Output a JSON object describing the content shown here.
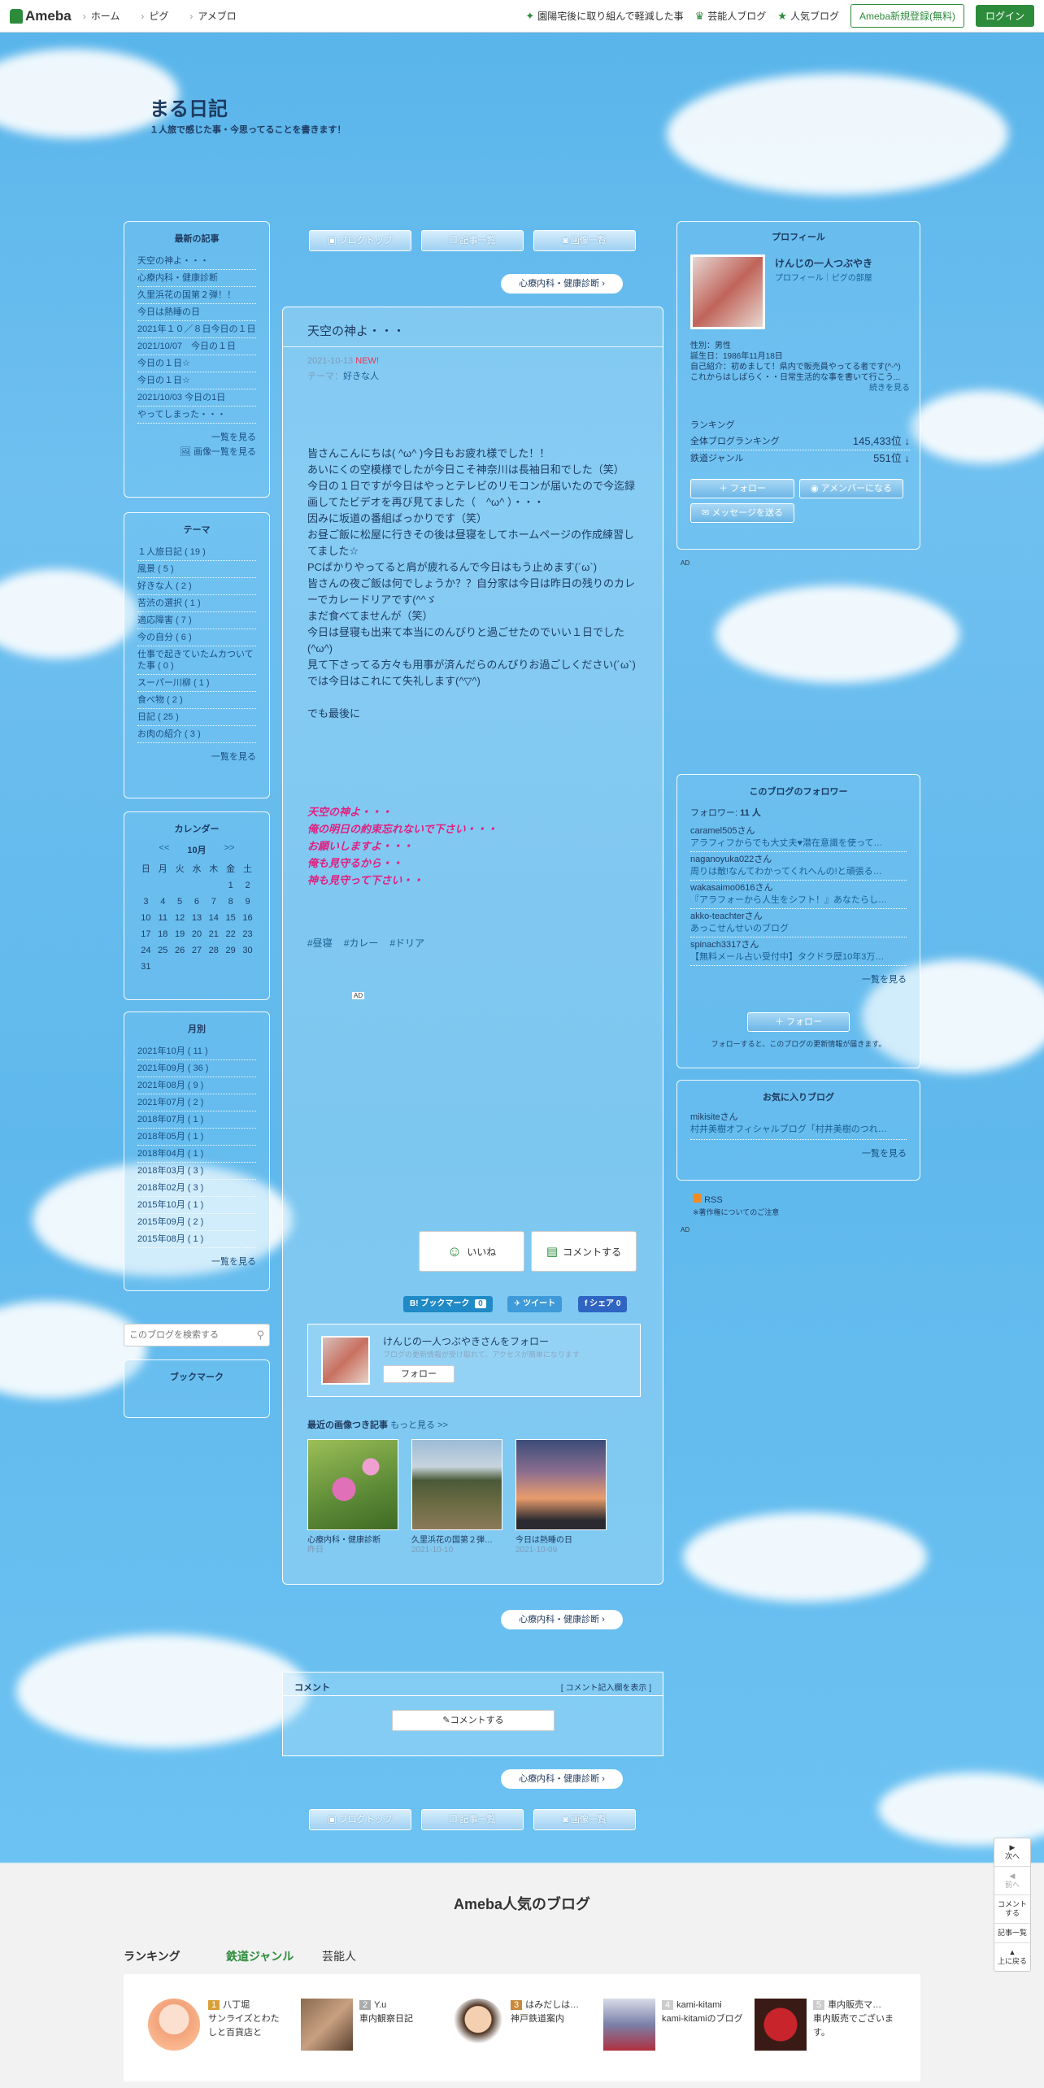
{
  "topbar": {
    "logo": "Ameba",
    "nav": [
      "ホーム",
      "ピグ",
      "アメブロ"
    ],
    "links": [
      "園陽宅後に取り組んで軽減した事",
      "芸能人ブログ",
      "人気ブログ"
    ],
    "register": "Ameba新規登録(無料)",
    "login": "ログイン"
  },
  "blog": {
    "title": "まる日記",
    "description": "１人旅で感じた事・今思ってることを書きます！"
  },
  "nav_buttons": {
    "top": "ブログトップ",
    "list": "記事一覧",
    "images": "画像一覧"
  },
  "next_article": "心療内科・健康診断",
  "latest": {
    "heading": "最新の記事",
    "items": [
      "天空の神よ・・・",
      "心療内科・健康診断",
      "久里浜花の国第２弾！！",
      "今日は熱睡の日",
      "2021年１０／８日今日の１日",
      "2021/10/07　今日の１日",
      "今日の１日☆",
      "今日の１日☆",
      "2021/10/03 今日の1日",
      "やってしまった・・・"
    ],
    "more": "一覧を見る",
    "images_more": "画像一覧を見る"
  },
  "themes": {
    "heading": "テーマ",
    "items": [
      "１人旅日記 ( 19 )",
      "風景 ( 5 )",
      "好きな人 ( 2 )",
      "苦渋の選択 ( 1 )",
      "適応障害 ( 7 )",
      "今の自分 ( 6 )",
      "仕事で起きていたムカついてた事 ( 0 )",
      "スーパー川柳 ( 1 )",
      "食べ物 ( 2 )",
      "日記 ( 25 )",
      "お肉の紹介 ( 3 )"
    ],
    "more": "一覧を見る"
  },
  "calendar": {
    "heading": "カレンダー",
    "prev": "<<",
    "month": "10月",
    "next": ">>",
    "weekdays": [
      "日",
      "月",
      "火",
      "水",
      "木",
      "金",
      "土"
    ],
    "weeks": [
      [
        "",
        "",
        "",
        "",
        "",
        "1",
        "2"
      ],
      [
        "3",
        "4",
        "5",
        "6",
        "7",
        "8",
        "9"
      ],
      [
        "10",
        "11",
        "12",
        "13",
        "14",
        "15",
        "16"
      ],
      [
        "17",
        "18",
        "19",
        "20",
        "21",
        "22",
        "23"
      ],
      [
        "24",
        "25",
        "26",
        "27",
        "28",
        "29",
        "30"
      ],
      [
        "31",
        "",
        "",
        "",
        "",
        "",
        ""
      ]
    ]
  },
  "monthly": {
    "heading": "月別",
    "items": [
      "2021年10月 ( 11 )",
      "2021年09月 ( 36 )",
      "2021年08月 ( 9 )",
      "2021年07月 ( 2 )",
      "2018年07月 ( 1 )",
      "2018年05月 ( 1 )",
      "2018年04月 ( 1 )",
      "2018年03月 ( 3 )",
      "2018年02月 ( 3 )",
      "2015年10月 ( 1 )",
      "2015年09月 ( 2 )",
      "2015年08月 ( 1 )"
    ],
    "more": "一覧を見る"
  },
  "search": {
    "placeholder": "このブログを検索する"
  },
  "bookmark": {
    "heading": "ブックマーク"
  },
  "article": {
    "title": "天空の神よ・・・",
    "date": "2021-10-13",
    "new_badge": "NEW!",
    "theme_label": "テーマ：",
    "theme": "好きな人",
    "body": "皆さんこんにちは( ^ω^ )今日もお疲れ様でした！！\nあいにくの空模様でしたが今日こそ神奈川は長袖日和でした（笑）\n今日の１日ですが今日はやっとテレビのリモコンが届いたので今迄録画してたビデオを再び見てました（　^ω^ ）・・・\n因みに坂道の番組ばっかりです（笑）\nお昼ご飯に松屋に行きその後は昼寝をしてホームページの作成練習してました☆\nPCばかりやってると肩が疲れるんで今日はもう止めます(´ω`)\n皆さんの夜ご飯は何でしょうか？？自分家は今日は昨日の残りのカレーでカレードリアです(^^ゞ\nまだ食べてませんが（笑）\n今日は昼寝も出来て本当にのんびりと過ごせたのでいい１日でした(^ω^)\n見て下さってる方々も用事が済んだらのんびりお過ごしください(´ω`)\nでは今日はこれにて失礼します(^▽^)\n\nでも最後に",
    "pink": "天空の神よ・・・\n俺の明日の約束忘れないで下さい・・・\nお願いしますよ・・・\n俺も見守るから・・\n神も見守って下さい・・",
    "tags": [
      "#昼寝",
      "#カレー",
      "#ドリア"
    ],
    "ad": "AD",
    "like": "いいね",
    "comment_btn": "コメントする",
    "hatena": "B! ブックマーク",
    "hatena_count": "0",
    "tweet": "ツイート",
    "share": "シェア",
    "share_count": "0",
    "follow_title": "けんじの一人つぶやきさんをフォロー",
    "follow_sub": "ブログの更新情報が受け取れて、アクセスが簡単になります",
    "follow_btn": "フォロー",
    "recent_heading": "最近の画像つき記事",
    "recent_more": "もっと見る >>",
    "recent": [
      {
        "title": "心療内科・健康診断",
        "date": "昨日"
      },
      {
        "title": "久里浜花の国第２弾…",
        "date": "2021-10-10"
      },
      {
        "title": "今日は熱睡の日",
        "date": "2021-10-09"
      }
    ]
  },
  "comments": {
    "heading": "コメント",
    "show": "[ コメント記入欄を表示 ]",
    "button": "コメントする"
  },
  "profile": {
    "heading": "プロフィール",
    "name": "けんじの一人つぶやき",
    "sub": "プロフィール｜ピグの部屋",
    "gender": "性別：男性",
    "birthday": "誕生日：1986年11月18日",
    "intro": "自己紹介：初めまして！県内で販売員やってる者です(^-^) これからはしばらく・・日常生活的な事を書いて行こう...",
    "more": "続きを見る",
    "ranking_label": "ランキング",
    "rank1_label": "全体ブログランキング",
    "rank1": "145,433位",
    "rank2_label": "鉄道ジャンル",
    "rank2": "551位",
    "follow": "フォロー",
    "member": "アメンバーになる",
    "message": "メッセージを送る"
  },
  "followers": {
    "heading": "このブログのフォロワー",
    "count_label": "フォロワー:",
    "count": "11 人",
    "items": [
      {
        "name": "caramel505さん",
        "blog": "アラフィフからでも大丈夫♥潜在意識を使って…"
      },
      {
        "name": "naganoyuka022さん",
        "blog": "周りは敵!なんてわかってくれへんの!と頑張る…"
      },
      {
        "name": "wakasaimo0616さん",
        "blog": "『アラフォーから人生をシフト！』あなたらし…"
      },
      {
        "name": "akko-teachterさん",
        "blog": "あっこせんせいのブログ"
      },
      {
        "name": "spinach3317さん",
        "blog": "【無料メール占い受付中】タクドラ歴10年3万…"
      }
    ],
    "more": "一覧を見る",
    "follow": "フォロー",
    "note": "フォローすると、このブログの更新情報が届きます。"
  },
  "favorites": {
    "heading": "お気に入りブログ",
    "items": [
      {
        "name": "mikisiteさん",
        "blog": "村井美樹オフィシャルブログ「村井美樹のつれ…"
      }
    ],
    "more": "一覧を見る"
  },
  "rss": {
    "label": "RSS",
    "note": "※著作権についてのご注意"
  },
  "float": {
    "next": "次へ",
    "prev": "前へ",
    "comment": "コメントする",
    "list": "記事一覧",
    "top": "上に戻る"
  },
  "popular": {
    "heading": "Ameba人気のブログ",
    "tabs": [
      "ランキング",
      "鉄道ジャンル",
      "芸能人"
    ],
    "items": [
      {
        "rank": "1",
        "name": "八丁堀",
        "desc": "サンライズとわたしと百貨店と"
      },
      {
        "rank": "2",
        "name": "Y.u",
        "desc": "車内観察日記"
      },
      {
        "rank": "3",
        "name": "はみだしは…",
        "desc": "神戸鉄道案内"
      },
      {
        "rank": "4",
        "name": "kami-kitami",
        "desc": "kami-kitamiのブログ"
      },
      {
        "rank": "5",
        "name": "車内販売マ…",
        "desc": "車内販売でございます。"
      }
    ]
  }
}
